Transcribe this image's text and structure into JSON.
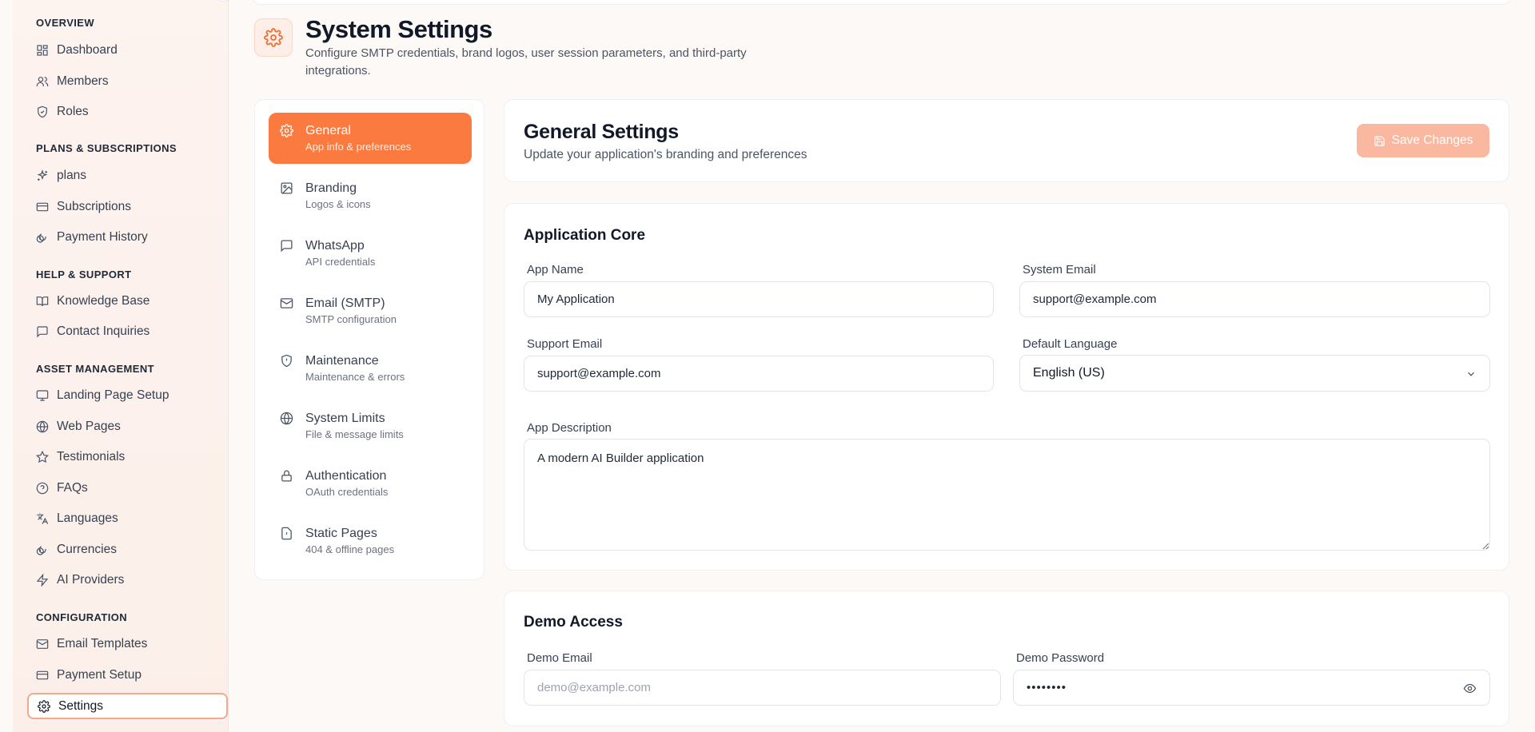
{
  "sidebar": {
    "sections": {
      "overview": "OVERVIEW",
      "plans": "PLANS & SUBSCRIPTIONS",
      "help": "HELP & SUPPORT",
      "asset": "ASSET MANAGEMENT",
      "config": "CONFIGURATION"
    },
    "items": {
      "dashboard": "Dashboard",
      "members": "Members",
      "roles": "Roles",
      "plans": "plans",
      "subscriptions": "Subscriptions",
      "payment_history": "Payment History",
      "knowledge_base": "Knowledge Base",
      "contact_inquiries": "Contact Inquiries",
      "landing_page_setup": "Landing Page Setup",
      "web_pages": "Web Pages",
      "testimonials": "Testimonials",
      "faqs": "FAQs",
      "languages": "Languages",
      "currencies": "Currencies",
      "ai_providers": "AI Providers",
      "email_templates": "Email Templates",
      "payment_setup": "Payment Setup",
      "settings": "Settings"
    }
  },
  "header": {
    "title": "System Settings",
    "subtitle": "Configure SMTP credentials, brand logos, user session parameters, and third-party integrations."
  },
  "settings_nav": [
    {
      "label": "General",
      "sub": "App info & preferences"
    },
    {
      "label": "Branding",
      "sub": "Logos & icons"
    },
    {
      "label": "WhatsApp",
      "sub": "API credentials"
    },
    {
      "label": "Email (SMTP)",
      "sub": "SMTP configuration"
    },
    {
      "label": "Maintenance",
      "sub": "Maintenance & errors"
    },
    {
      "label": "System Limits",
      "sub": "File & message limits"
    },
    {
      "label": "Authentication",
      "sub": "OAuth credentials"
    },
    {
      "label": "Static Pages",
      "sub": "404 & offline pages"
    }
  ],
  "general": {
    "title": "General Settings",
    "subtitle": "Update your application's branding and preferences",
    "save_label": "Save Changes"
  },
  "app_core": {
    "title": "Application Core",
    "app_name_label": "App Name",
    "app_name_value": "My Application",
    "system_email_label": "System Email",
    "system_email_value": "support@example.com",
    "support_email_label": "Support Email",
    "support_email_value": "support@example.com",
    "default_language_label": "Default Language",
    "default_language_value": "English (US)",
    "app_description_label": "App Description",
    "app_description_value": "A modern AI Builder application"
  },
  "demo": {
    "title": "Demo Access",
    "email_label": "Demo Email",
    "email_placeholder": "demo@example.com",
    "password_label": "Demo Password",
    "password_value": "••••••••"
  },
  "colors": {
    "accent": "#fb7a3f",
    "accent_light": "#fbb8a0"
  }
}
